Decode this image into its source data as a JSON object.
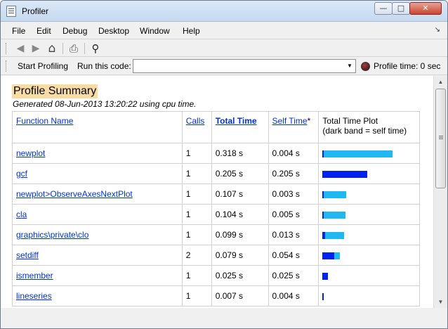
{
  "window": {
    "title": "Profiler",
    "min_glyph": "—",
    "max_glyph": "□",
    "close_glyph": "✕"
  },
  "menu": {
    "items": [
      "File",
      "Edit",
      "Debug",
      "Desktop",
      "Window",
      "Help"
    ],
    "dock_glyph": "↘"
  },
  "toolbar": {
    "back_glyph": "◀",
    "forward_glyph": "▶",
    "home_glyph": "⌂",
    "print_glyph": "⎙",
    "find_glyph": "⚲"
  },
  "runbar": {
    "start_label": "Start Profiling",
    "run_label": "Run this code:",
    "code_value": "",
    "dropdown_glyph": "▼",
    "profile_time": "Profile time: 0 sec"
  },
  "summary": {
    "title": "Profile Summary",
    "generated": "Generated 08-Jun-2013 13:20:22 using cpu time."
  },
  "table": {
    "headers": {
      "function_name": "Function Name",
      "calls": "Calls",
      "total_time": "Total Time",
      "self_time": "Self Time",
      "self_time_mark": "*",
      "plot_line1": "Total Time Plot",
      "plot_line2": "(dark band = self time)"
    },
    "rows": [
      {
        "name": "newplot",
        "calls": "1",
        "total": "0.318 s",
        "self": "0.004 s",
        "total_s": 0.318,
        "self_s": 0.004
      },
      {
        "name": "gcf",
        "calls": "1",
        "total": "0.205 s",
        "self": "0.205 s",
        "total_s": 0.205,
        "self_s": 0.205
      },
      {
        "name": "newplot>ObserveAxesNextPlot",
        "calls": "1",
        "total": "0.107 s",
        "self": "0.003 s",
        "total_s": 0.107,
        "self_s": 0.003
      },
      {
        "name": "cla",
        "calls": "1",
        "total": "0.104 s",
        "self": "0.005 s",
        "total_s": 0.104,
        "self_s": 0.005
      },
      {
        "name": "graphics\\private\\clo",
        "calls": "1",
        "total": "0.099 s",
        "self": "0.013 s",
        "total_s": 0.099,
        "self_s": 0.013
      },
      {
        "name": "setdiff",
        "calls": "2",
        "total": "0.079 s",
        "self": "0.054 s",
        "total_s": 0.079,
        "self_s": 0.054
      },
      {
        "name": "ismember",
        "calls": "1",
        "total": "0.025 s",
        "self": "0.025 s",
        "total_s": 0.025,
        "self_s": 0.025
      },
      {
        "name": "lineseries",
        "calls": "1",
        "total": "0.007 s",
        "self": "0.004 s",
        "total_s": 0.007,
        "self_s": 0.004
      }
    ]
  },
  "colors": {
    "total_bar": "#1fb8f0",
    "self_bar": "#0022ee",
    "title_highlight": "#f9dca5",
    "link": "#0033cc"
  },
  "scrollbar": {
    "up_glyph": "▲",
    "down_glyph": "▼"
  }
}
